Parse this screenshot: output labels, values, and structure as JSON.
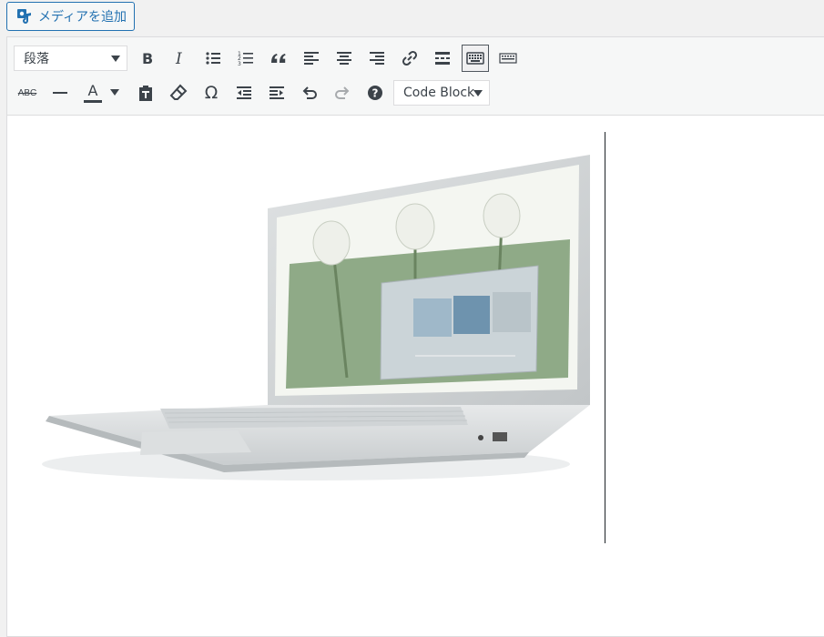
{
  "media_button": {
    "label": "メディアを追加"
  },
  "toolbar": {
    "format_select": "段落",
    "code_select": "Code Block",
    "text_color_letter": "A",
    "strike_letters": "ABC",
    "row1": [
      "bold",
      "italic",
      "bullet-list",
      "numbered-list",
      "blockquote",
      "align-left",
      "align-center",
      "align-right",
      "link",
      "read-more",
      "toolbar-toggle",
      "distraction-free"
    ],
    "row2": [
      "strikethrough",
      "horizontal-rule",
      "text-color",
      "paste-text",
      "clear-formatting",
      "special-character",
      "outdent",
      "indent",
      "undo",
      "redo",
      "help"
    ]
  },
  "colors": {
    "accent": "#2271b1",
    "icon": "#3c434a",
    "disabled": "#a7aaad"
  },
  "content": {
    "image": "laptop-photo"
  }
}
